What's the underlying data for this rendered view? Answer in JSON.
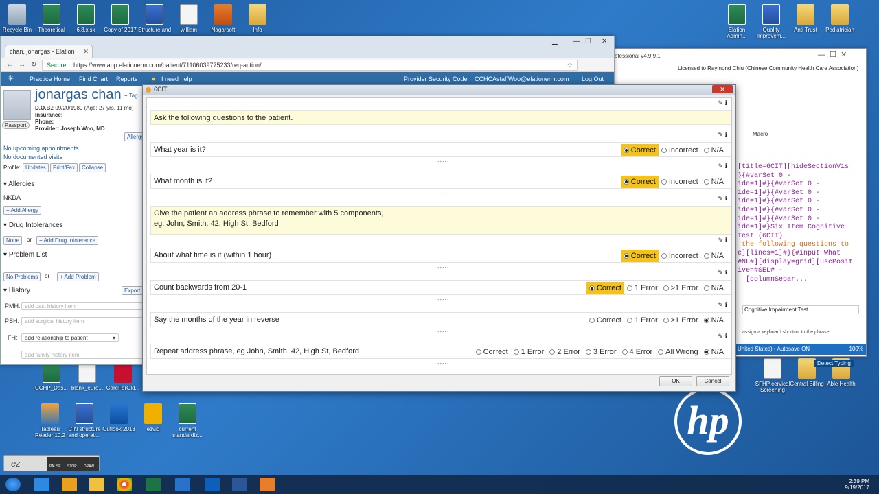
{
  "desktop": {
    "icons_top": [
      {
        "label": "Recycle Bin",
        "icon": "recycle-bin-icon",
        "kind": "bin"
      },
      {
        "label": "Theoretical",
        "icon": "excel-icon",
        "kind": "excel"
      },
      {
        "label": "6.8.xlsx",
        "icon": "excel-icon",
        "kind": "excel"
      },
      {
        "label": "Copy of 2017",
        "icon": "excel-icon",
        "kind": "excel"
      },
      {
        "label": "Structure and",
        "icon": "word-icon",
        "kind": "word"
      },
      {
        "label": "william",
        "icon": "document-icon",
        "kind": "doc"
      },
      {
        "label": "Nagarsoft",
        "icon": "app-icon",
        "kind": "app"
      },
      {
        "label": "Info",
        "icon": "folder-icon",
        "kind": "folder"
      }
    ],
    "icons_right": [
      {
        "label": "Elation Admin...",
        "icon": "excel-icon",
        "kind": "excel"
      },
      {
        "label": "Quality Improvem...",
        "icon": "word-icon",
        "kind": "word"
      },
      {
        "label": "Anti Trust",
        "icon": "folder-icon",
        "kind": "folder"
      },
      {
        "label": "Pediatrician",
        "icon": "folder-icon",
        "kind": "folder"
      }
    ],
    "icons_bottom_left": [
      {
        "label": "Tableau Reader 10.2",
        "icon": "tableau-icon",
        "kind": "tab"
      },
      {
        "label": "CIN structure and operati...",
        "icon": "word-icon",
        "kind": "word"
      },
      {
        "label": "Outlook 2013",
        "icon": "outlook-icon",
        "kind": "outlook"
      },
      {
        "label": "ezvid",
        "icon": "ezvid-icon",
        "kind": "ezvid"
      },
      {
        "label": "current standardiz...",
        "icon": "excel-icon",
        "kind": "excel"
      }
    ],
    "icons_mid_left": [
      {
        "label": "CCHP_Das...",
        "icon": "excel-icon",
        "kind": "excel"
      },
      {
        "label": "blank_euro...",
        "icon": "document-icon",
        "kind": "doc"
      },
      {
        "label": "CareForOld...",
        "icon": "pdf-icon",
        "kind": "pdf"
      }
    ],
    "icons_right_bottom": [
      {
        "label": "SFHP cervical Screening",
        "icon": "document-icon",
        "kind": "doc"
      },
      {
        "label": "Central Billing",
        "icon": "folder-icon",
        "kind": "folder"
      },
      {
        "label": "Able Health",
        "icon": "folder-icon",
        "kind": "folder"
      }
    ],
    "brand": "hp"
  },
  "browser": {
    "tab_title": "chan, jonargas - Elation",
    "url": "https://www.app.elationemr.com/patient/71106039775233/req-action/",
    "secure_label": "Secure",
    "nav": {
      "practice_home": "Practice Home",
      "find_chart": "Find Chart",
      "reports": "Reports",
      "need_help": "I need help",
      "provider_code": "Provider Security Code",
      "user": "CCHCAstaffWoo@elationemr.com",
      "logout": "Log Out"
    }
  },
  "patient": {
    "name": "jonargas chan",
    "tag": "+ Tag",
    "dob_label": "D.O.B.:",
    "dob": "09/20/1989 (Age: 27 yrs, 11 mo)",
    "insurance_label": "Insurance:",
    "phone_label": "Phone:",
    "provider_label": "Provider:",
    "provider": "Joseph Woo, MD",
    "passport": "Passport",
    "allergy_btn": "Allergy",
    "no_appointments": "No upcoming appointments",
    "no_visits": "No documented visits",
    "profile_label": "Profile:",
    "profile_updates": "Updates",
    "profile_print": "Print/Fax",
    "profile_collapse": "Collapse",
    "allergies_title": "Allergies",
    "allergies_value": "NKDA",
    "add_allergy": "+ Add Allergy",
    "drug_title": "Drug Intolerances",
    "drug_none": "None",
    "drug_or": "or",
    "drug_add": "+ Add Drug Intolerance",
    "problem_title": "Problem List",
    "no_problems": "No Problems",
    "problem_or": "or",
    "add_problem": "+ Add Problem",
    "history_title": "History",
    "export": "Export",
    "pmh_label": "PMH:",
    "pmh_placeholder": "add past history item",
    "psh_label": "PSH:",
    "psh_placeholder": "add surgical history item",
    "fh_label": "FH:",
    "fh_select": "add relationship to patient",
    "family_placeholder": "add family history item"
  },
  "bgapp": {
    "title_partial": "ofessional v4.9.9.1",
    "license": "Licensed to Raymond Chiu (Chinese Community Health Care Association)",
    "macro": "Macro",
    "code_lines": [
      "[title=6CIT][hideSectionVis",
      "}{#varSet 0 -",
      "ide=1]#}{#varSet 0 -",
      "ide=1]#}{#varSet 0 -",
      "ide=1]#}{#varSet 0 -",
      "ide=1]#}{#varSet 0 -",
      "ide=1]#}{#varSet 0 -",
      "ide=1]#}Six Item Cognitive",
      "Test (6CIT)",
      " the following questions to",
      "",
      "e][lines=1]#}{#input What",
      "",
      "#NL#][display=grid][usePosit",
      "ive=#SEL# -",
      "  [columnSepar..."
    ],
    "phrase_name": "Cognitive Impairment Test",
    "shortcut_hint": "assign a keyboard shortcut to the phrase",
    "language_status": "United States) • Autosave ON",
    "zoom": "100%",
    "detect_typing": "Detect Typing"
  },
  "modal": {
    "title": "6CIT",
    "intro": "Ask the following questions to the patient.",
    "address_instruction_line1": "Give the patient an address phrase to remember with 5 components,",
    "address_instruction_line2": "eg: John, Smith, 42, High St, Bedford",
    "dots": ".....",
    "questions": [
      {
        "text": "What year is it?",
        "options": [
          {
            "label": "Correct",
            "selected": true
          },
          {
            "label": "Incorrect",
            "selected": false
          },
          {
            "label": "N/A",
            "selected": false
          }
        ]
      },
      {
        "text": "What month is it?",
        "options": [
          {
            "label": "Correct",
            "selected": true
          },
          {
            "label": "Incorrect",
            "selected": false
          },
          {
            "label": "N/A",
            "selected": false
          }
        ]
      },
      {
        "text": "About what time is it (within 1 hour)",
        "options": [
          {
            "label": "Correct",
            "selected": true
          },
          {
            "label": "Incorrect",
            "selected": false
          },
          {
            "label": "N/A",
            "selected": false
          }
        ]
      },
      {
        "text": "Count backwards from 20-1",
        "options": [
          {
            "label": "Correct",
            "selected": true
          },
          {
            "label": "1 Error",
            "selected": false
          },
          {
            "label": ">1 Error",
            "selected": false
          },
          {
            "label": "N/A",
            "selected": false
          }
        ]
      },
      {
        "text": "Say the months of the year in reverse",
        "options": [
          {
            "label": "Correct",
            "selected": false
          },
          {
            "label": "1 Error",
            "selected": false
          },
          {
            "label": ">1 Error",
            "selected": false
          },
          {
            "label": "N/A",
            "selected": true
          }
        ]
      },
      {
        "text": "Repeat address phrase, eg John, Smith, 42, High St, Bedford",
        "options": [
          {
            "label": "Correct",
            "selected": false
          },
          {
            "label": "1 Error",
            "selected": false
          },
          {
            "label": "2 Error",
            "selected": false
          },
          {
            "label": "3 Error",
            "selected": false
          },
          {
            "label": "4 Error",
            "selected": false
          },
          {
            "label": "All Wrong",
            "selected": false
          },
          {
            "label": "N/A",
            "selected": true
          }
        ]
      }
    ],
    "ok": "OK",
    "cancel": "Cancel"
  },
  "ezvid_bar": {
    "pause": "PAUSE",
    "stop": "STOP",
    "draw": "DRAW"
  },
  "taskbar": {
    "time": "2:39 PM",
    "date": "9/19/2017"
  },
  "colors": {
    "selected_highlight": "#f3c21b",
    "instruction_bg": "#fdfbd9",
    "nav_bg": "#2f6ea8"
  }
}
